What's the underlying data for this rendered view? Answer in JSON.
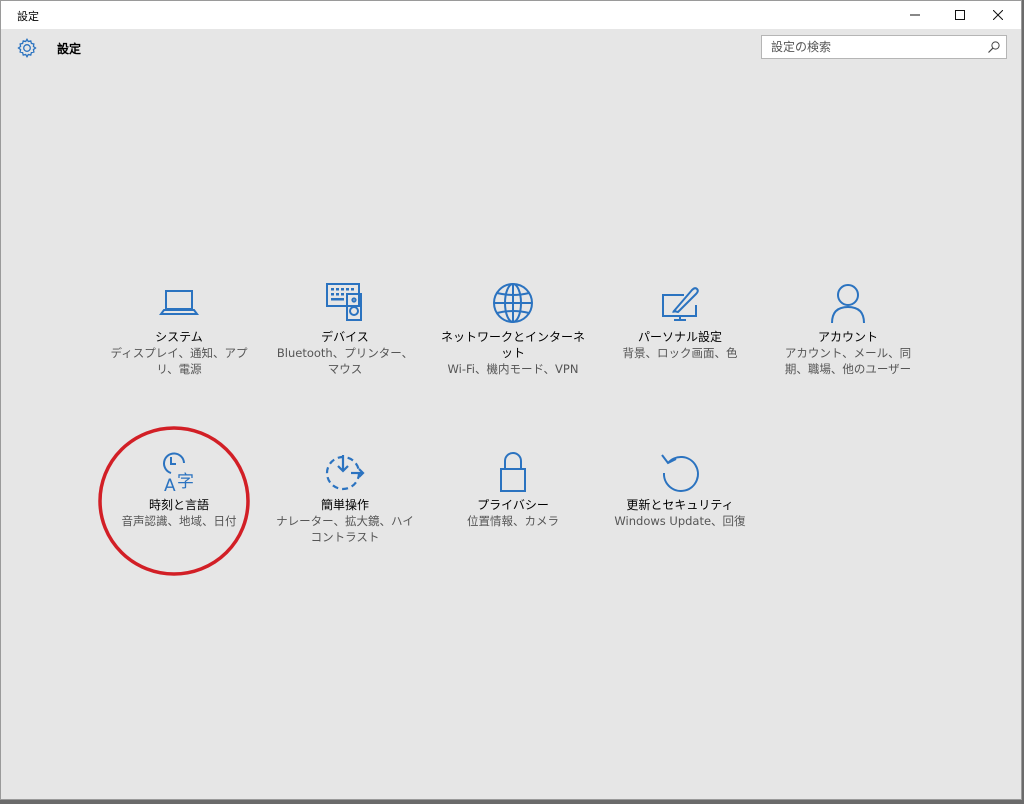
{
  "window": {
    "title": "設定",
    "controls": {
      "minimize": "minimize-icon",
      "maximize": "maximize-icon",
      "close": "close-icon"
    }
  },
  "header": {
    "icon": "gear-icon",
    "title": "設定"
  },
  "search": {
    "placeholder": "設定の検索",
    "value": "",
    "icon": "search-icon"
  },
  "colors": {
    "accent": "#2b73c0",
    "highlight_circle": "#d21f26",
    "background": "#e6e6e6",
    "description_text": "#555555"
  },
  "tiles": [
    {
      "icon": "laptop-icon",
      "label": "システム",
      "description": "ディスプレイ、通知、アプリ、電源"
    },
    {
      "icon": "keyboard-speaker-icon",
      "label": "デバイス",
      "description": "Bluetooth、プリンター、マウス"
    },
    {
      "icon": "globe-icon",
      "label": "ネットワークとインターネット",
      "description": "Wi-Fi、機内モード、VPN"
    },
    {
      "icon": "paint-monitor-icon",
      "label": "パーソナル設定",
      "description": "背景、ロック画面、色"
    },
    {
      "icon": "person-icon",
      "label": "アカウント",
      "description": "アカウント、メール、同期、職場、他のユーザー"
    },
    {
      "icon": "time-language-icon",
      "label": "時刻と言語",
      "description": "音声認識、地域、日付"
    },
    {
      "icon": "ease-of-access-icon",
      "label": "簡単操作",
      "description": "ナレーター、拡大鏡、ハイコントラスト"
    },
    {
      "icon": "lock-icon",
      "label": "プライバシー",
      "description": "位置情報、カメラ"
    },
    {
      "icon": "refresh-icon",
      "label": "更新とセキュリティ",
      "description": "Windows Update、回復"
    }
  ],
  "annotation": {
    "highlighted_tile": "時刻と言語"
  }
}
